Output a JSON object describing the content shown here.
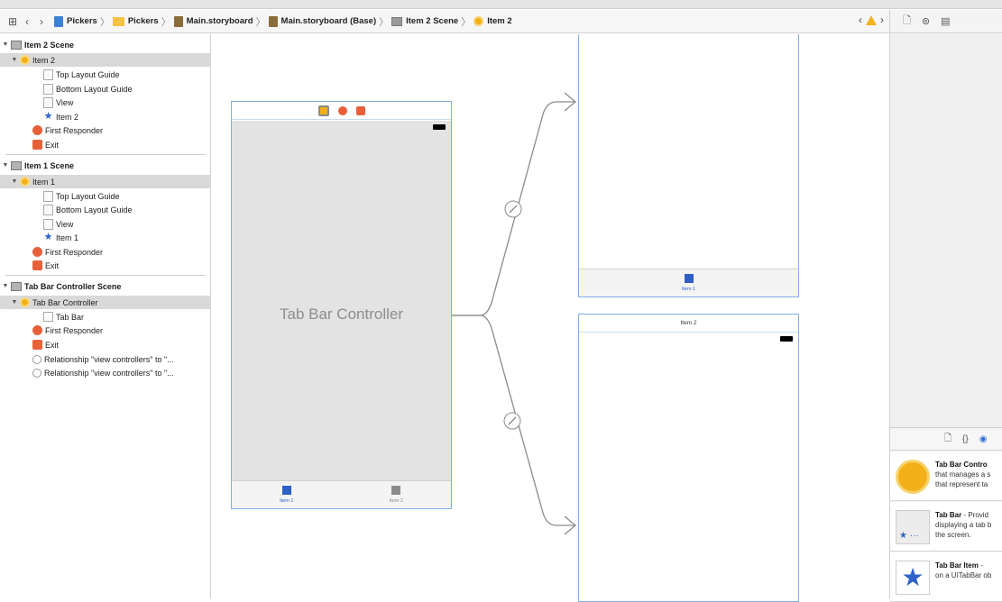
{
  "jumpbar": {
    "crumbs": [
      {
        "label": "Pickers",
        "icon": "project-icon"
      },
      {
        "label": "Pickers",
        "icon": "folder-icon"
      },
      {
        "label": "Main.storyboard",
        "icon": "storyboard-icon"
      },
      {
        "label": "Main.storyboard (Base)",
        "icon": "storyboard-icon"
      },
      {
        "label": "Item 2 Scene",
        "icon": "scene-icon"
      },
      {
        "label": "Item 2",
        "icon": "view-controller-icon"
      }
    ]
  },
  "outline": {
    "scenes": [
      {
        "title": "Item 2 Scene",
        "controller": "Item 2",
        "children": [
          "Top Layout Guide",
          "Bottom Layout Guide",
          "View",
          "Item 2"
        ],
        "first_responder": "First Responder",
        "exit": "Exit"
      },
      {
        "title": "Item 1 Scene",
        "controller": "Item 1",
        "children": [
          "Top Layout Guide",
          "Bottom Layout Guide",
          "View",
          "Item 1"
        ],
        "first_responder": "First Responder",
        "exit": "Exit"
      },
      {
        "title": "Tab Bar Controller Scene",
        "controller": "Tab Bar Controller",
        "children": [
          "Tab Bar"
        ],
        "first_responder": "First Responder",
        "exit": "Exit",
        "relationships": [
          "Relationship \"view controllers\" to \"...",
          "Relationship \"view controllers\" to \"..."
        ]
      }
    ]
  },
  "canvas": {
    "tab_bar_controller_title": "Tab Bar Controller",
    "tab_items": [
      "Item 1",
      "Item 2"
    ],
    "top_vc_tab_item": "Item 1",
    "bottom_vc_nav_title": "Item 2",
    "colors": {
      "selected_tab": "#2d5fc7",
      "unselected_tab": "#8a8a8a",
      "scene_border": "#7fb0e3",
      "segue": "#8a8a8a"
    }
  },
  "library": {
    "items": [
      {
        "title": "Tab Bar Contro",
        "desc1": "that manages a s",
        "desc2": "that represent ta"
      },
      {
        "title": "Tab Bar",
        "suffix": " - Provid",
        "desc1": "displaying a tab b",
        "desc2": "the screen."
      },
      {
        "title": "Tab Bar Item",
        "suffix": " - ",
        "desc1": "on a UITabBar ob",
        "desc2": ""
      }
    ]
  }
}
